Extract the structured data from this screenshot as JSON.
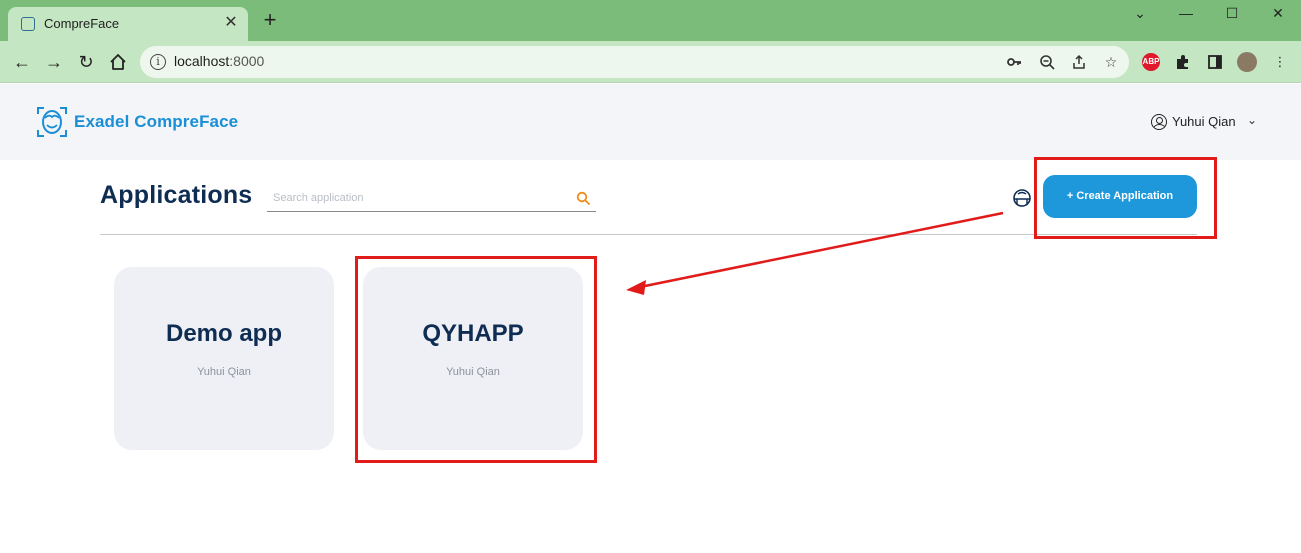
{
  "browser": {
    "tab_title": "CompreFace",
    "tab_close": "✕",
    "new_tab": "+",
    "url_host": "localhost",
    "url_port": ":8000",
    "window_minimize": "—",
    "window_maximize": "☐",
    "window_close": "✕",
    "window_dropdown": "⌄",
    "abp_label": "ABP"
  },
  "header": {
    "logo_text": "Exadel CompreFace",
    "user_name": "Yuhui Qian",
    "user_chevron": "⌄"
  },
  "main": {
    "title": "Applications",
    "search_placeholder": "Search application",
    "create_button": "+ Create Application",
    "applications": [
      {
        "name": "Demo app",
        "owner": "Yuhui Qian"
      },
      {
        "name": "QYHAPP",
        "owner": "Yuhui Qian"
      }
    ]
  },
  "colors": {
    "tabstrip": "#7bbc7a",
    "toolbar": "#c5e6c2",
    "brand": "#1a8fd6",
    "button": "#1e98db",
    "title": "#0f2d52",
    "annotation": "#e11a1a"
  }
}
